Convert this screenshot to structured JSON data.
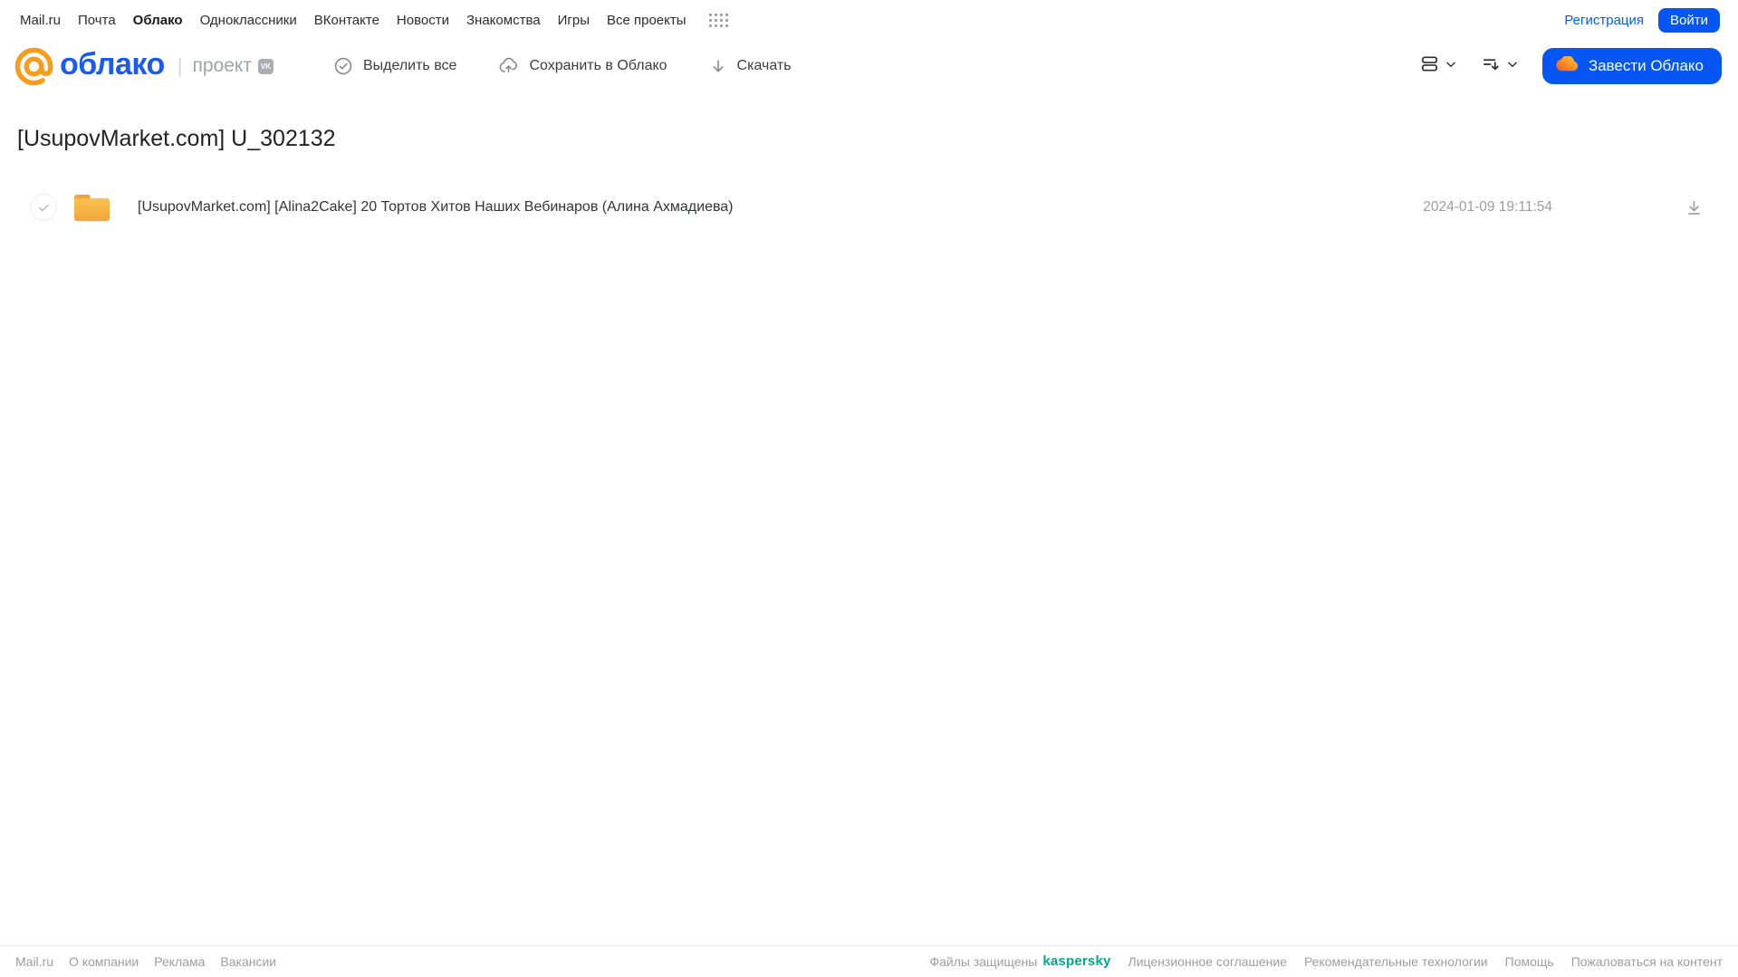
{
  "topbar": {
    "links": [
      "Mail.ru",
      "Почта",
      "Облако",
      "Одноклассники",
      "ВКонтакте",
      "Новости",
      "Знакомства",
      "Игры",
      "Все проекты"
    ],
    "active_link": "Облако",
    "registration_label": "Регистрация",
    "login_label": "Войти"
  },
  "header": {
    "logo_word": "облако",
    "project_label": "проект",
    "vk_badge": "VK",
    "toolbar": {
      "select_all": "Выделить все",
      "save_to_cloud": "Сохранить в Облако",
      "download": "Скачать"
    },
    "get_cloud_button": "Завести Облако"
  },
  "main": {
    "title": "[UsupovMarket.com] U_302132",
    "files": [
      {
        "type": "folder",
        "name": "[UsupovMarket.com] [Alina2Cake] 20 Тортов Хитов Наших Вебинаров (Алина Ахмадиева)",
        "date": "2024-01-09 19:11:54"
      }
    ]
  },
  "footer": {
    "left_links": [
      "Mail.ru",
      "О компании",
      "Реклама",
      "Вакансии"
    ],
    "protected_label": "Файлы защищены",
    "kaspersky_label": "kaspersky",
    "right_links": [
      "Лицензионное соглашение",
      "Рекомендательные технологии",
      "Помощь",
      "Пожаловаться на контент"
    ]
  },
  "colors": {
    "accent_blue": "#0556f3",
    "link_blue": "#005ff9",
    "logo_blue": "#1a5af0",
    "logo_orange": "#f89c1c",
    "folder_amber": "#f3ab3e",
    "kaspersky_green": "#00a88e",
    "muted_gray": "#9b9da1"
  }
}
